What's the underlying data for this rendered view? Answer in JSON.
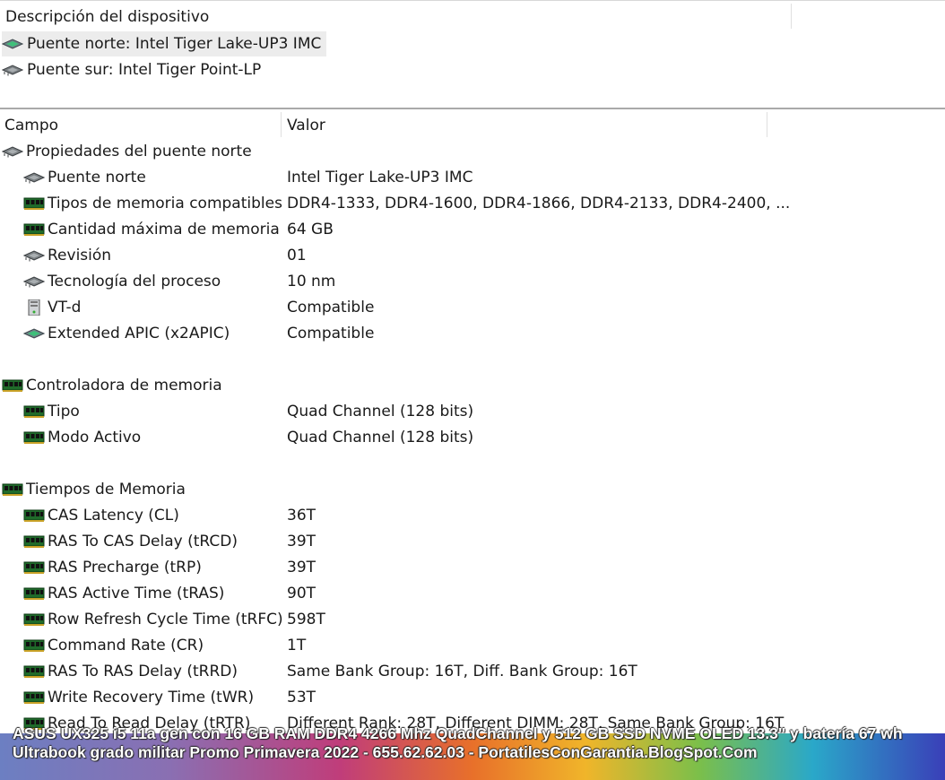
{
  "device_pane": {
    "header": "Descripción del dispositivo",
    "devices": [
      {
        "label": "Puente norte: Intel Tiger Lake-UP3 IMC",
        "icon": "chip-green-icon",
        "selected": true
      },
      {
        "label": "Puente sur: Intel Tiger Point-LP",
        "icon": "chip-gray-icon",
        "selected": false
      }
    ]
  },
  "list_pane": {
    "columns": {
      "field": "Campo",
      "value": "Valor"
    },
    "rows": [
      {
        "field": "Propiedades del puente norte",
        "value": "",
        "icon": "chip-gray-icon",
        "level": 0
      },
      {
        "field": "Puente norte",
        "value": "Intel Tiger Lake-UP3 IMC",
        "icon": "chip-gray-icon",
        "level": 1
      },
      {
        "field": "Tipos de memoria compatibles",
        "value": "DDR4-1333, DDR4-1600, DDR4-1866, DDR4-2133, DDR4-2400, ...",
        "icon": "memory-module-icon",
        "level": 1
      },
      {
        "field": "Cantidad máxima de memoria",
        "value": "64 GB",
        "icon": "memory-module-icon",
        "level": 1
      },
      {
        "field": "Revisión",
        "value": "01",
        "icon": "chip-gray-icon",
        "level": 1
      },
      {
        "field": "Tecnología del proceso",
        "value": "10 nm",
        "icon": "chip-gray-icon",
        "level": 1
      },
      {
        "field": "VT-d",
        "value": "Compatible",
        "icon": "computer-tower-icon",
        "level": 1
      },
      {
        "field": "Extended APIC (x2APIC)",
        "value": "Compatible",
        "icon": "chip-green-icon",
        "level": 1
      },
      {
        "field": "",
        "value": "",
        "icon": "",
        "level": 0
      },
      {
        "field": "Controladora de memoria",
        "value": "",
        "icon": "memory-module-icon",
        "level": 0
      },
      {
        "field": "Tipo",
        "value": "Quad Channel  (128 bits)",
        "icon": "memory-module-icon",
        "level": 1
      },
      {
        "field": "Modo Activo",
        "value": "Quad Channel  (128 bits)",
        "icon": "memory-module-icon",
        "level": 1
      },
      {
        "field": "",
        "value": "",
        "icon": "",
        "level": 0
      },
      {
        "field": "Tiempos de Memoria",
        "value": "",
        "icon": "memory-module-icon",
        "level": 0
      },
      {
        "field": "CAS Latency (CL)",
        "value": "36T",
        "icon": "memory-module-icon",
        "level": 1
      },
      {
        "field": "RAS To CAS Delay (tRCD)",
        "value": "39T",
        "icon": "memory-module-icon",
        "level": 1
      },
      {
        "field": "RAS Precharge (tRP)",
        "value": "39T",
        "icon": "memory-module-icon",
        "level": 1
      },
      {
        "field": "RAS Active Time (tRAS)",
        "value": "90T",
        "icon": "memory-module-icon",
        "level": 1
      },
      {
        "field": "Row Refresh Cycle Time (tRFC)",
        "value": "598T",
        "icon": "memory-module-icon",
        "level": 1
      },
      {
        "field": "Command Rate (CR)",
        "value": "1T",
        "icon": "memory-module-icon",
        "level": 1
      },
      {
        "field": "RAS To RAS Delay (tRRD)",
        "value": "Same Bank Group: 16T, Diff. Bank Group: 16T",
        "icon": "memory-module-icon",
        "level": 1
      },
      {
        "field": "Write Recovery Time (tWR)",
        "value": "53T",
        "icon": "memory-module-icon",
        "level": 1
      },
      {
        "field": "Read To Read Delay (tRTR)",
        "value": "Different Rank: 28T, Different DIMM: 28T, Same Bank Group: 16T",
        "icon": "memory-module-icon",
        "level": 1
      }
    ]
  },
  "banner": {
    "text": "ASUS UX325 i5 11a gen con 16 GB RAM DDR4 4266 Mhz QuadChannel y 512 GB SSD NVME OLED 13.3\" y batería 67 wh Ultrabook grado militar Promo Primavera 2022 - 655.62.62.03 - PortatilesConGarantia.BlogSpot.Com"
  }
}
